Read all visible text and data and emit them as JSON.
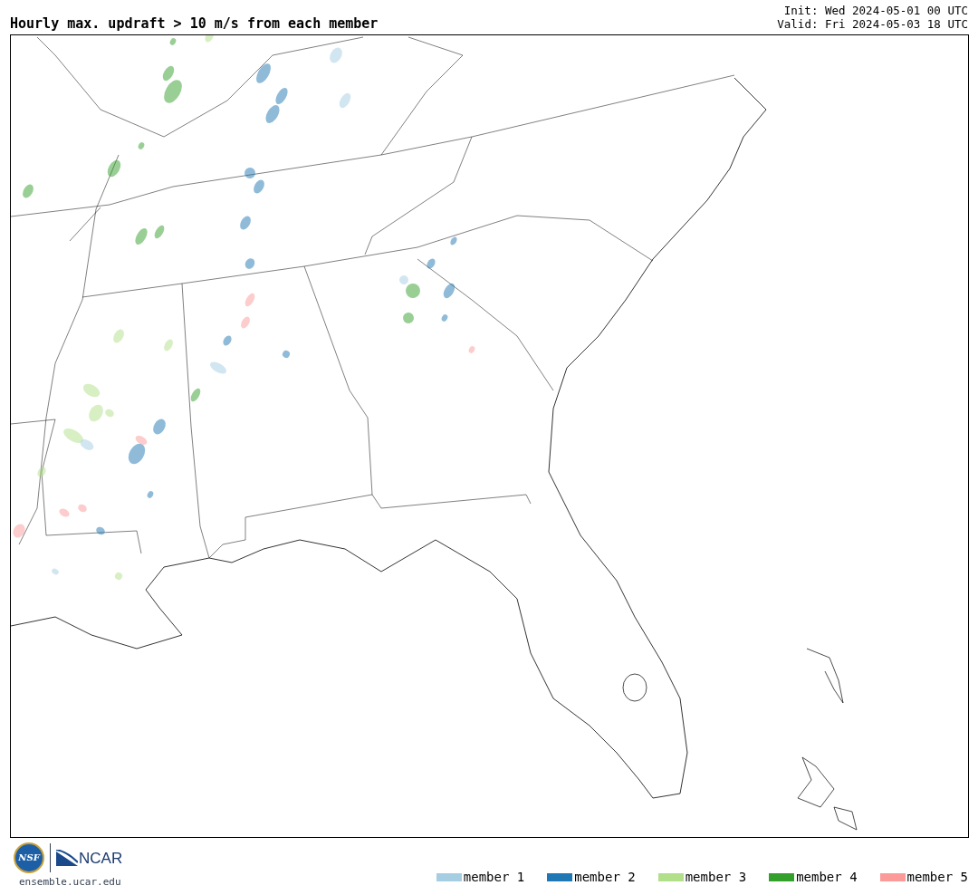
{
  "title": "Hourly max. updraft > 10 m/s from each member",
  "init": "Init: Wed 2024-05-01 00 UTC",
  "valid": "Valid: Fri 2024-05-03 18 UTC",
  "logos": {
    "nsf": "NSF",
    "ncar": "NCAR"
  },
  "site": "ensemble.ucar.edu",
  "legend": [
    {
      "label": "member 1",
      "color": "#a6cee3"
    },
    {
      "label": "member 2",
      "color": "#1f78b4"
    },
    {
      "label": "member 3",
      "color": "#b2df8a"
    },
    {
      "label": "member 4",
      "color": "#33a02c"
    },
    {
      "label": "member 5",
      "color": "#fb9a99"
    }
  ]
}
